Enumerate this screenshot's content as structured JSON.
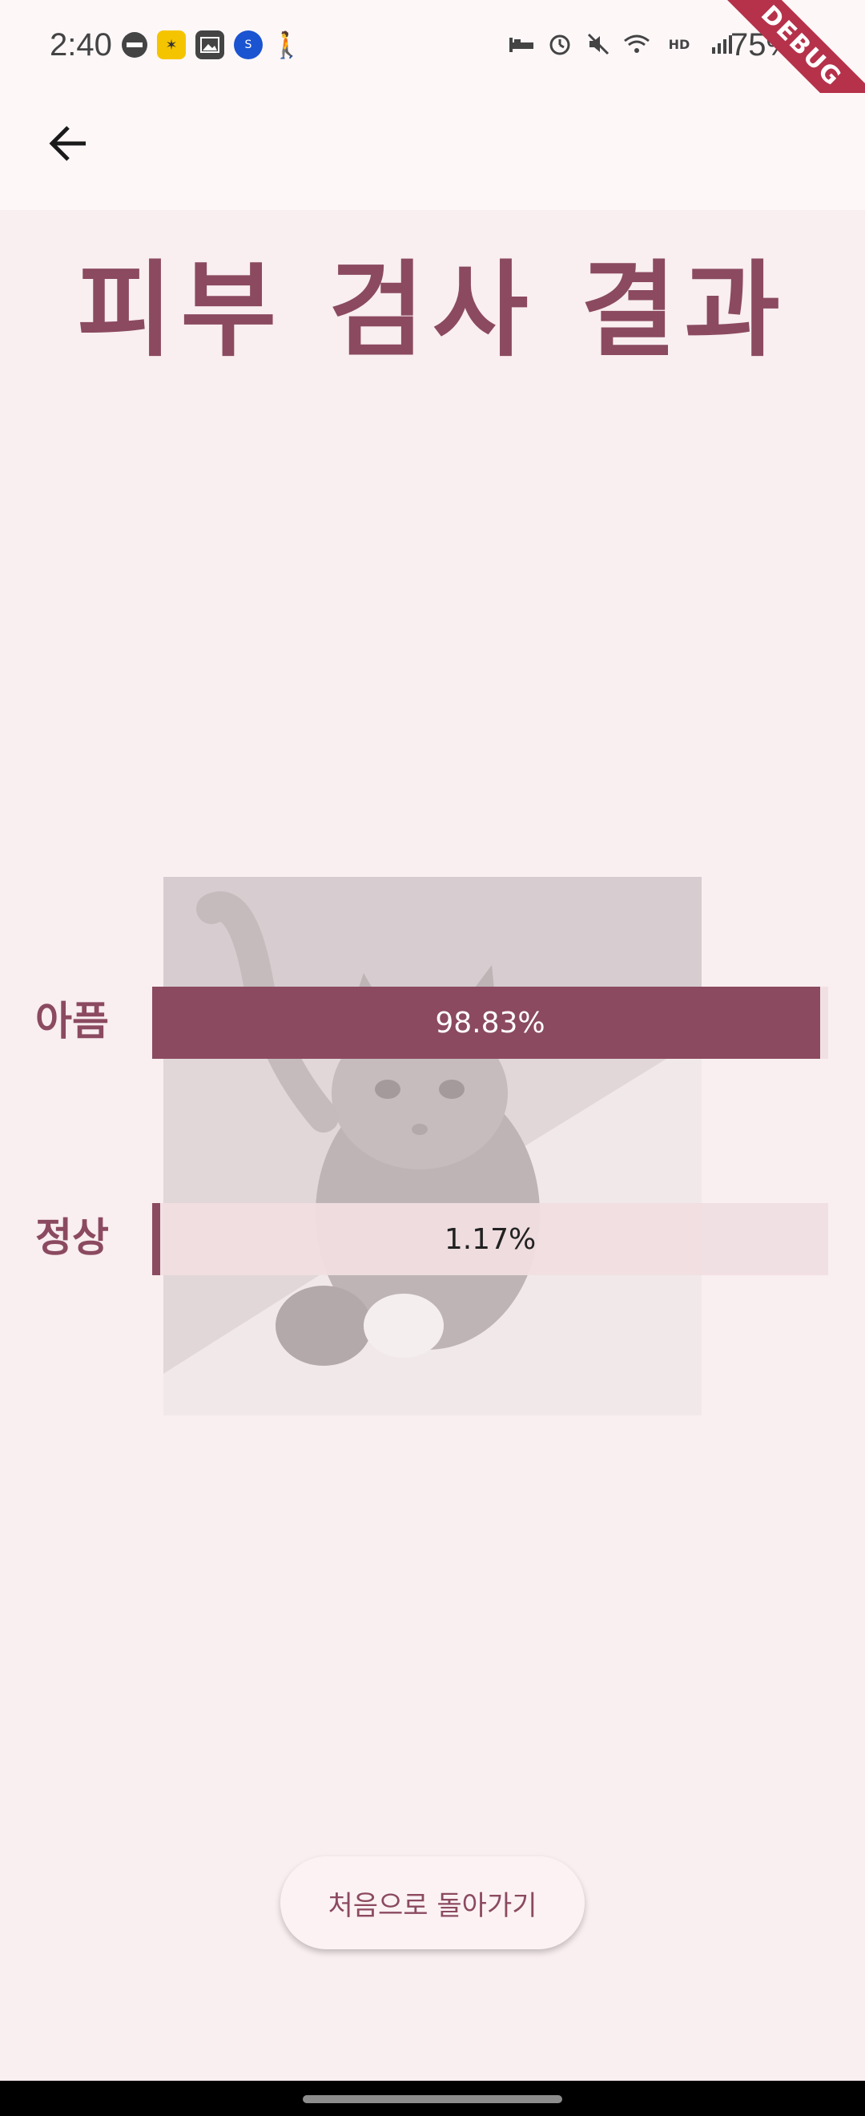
{
  "status_bar": {
    "time": "2:40",
    "battery": "75%",
    "left_icons": [
      "do-not-disturb-icon",
      "app-notification-icon",
      "gallery-icon",
      "super-sol-icon",
      "walking-icon"
    ],
    "right_icons": [
      "bed-icon",
      "alarm-icon",
      "mute-icon",
      "wifi-icon",
      "hd-voice-icon",
      "signal-icon"
    ],
    "debug_banner": "DEBUG"
  },
  "app_bar": {
    "back_icon": "arrow-left-icon"
  },
  "page": {
    "title": "피부 검사 결과"
  },
  "results": [
    {
      "label": "아픔",
      "value_text": "98.83%",
      "fraction": 0.9883
    },
    {
      "label": "정상",
      "value_text": "1.17%",
      "fraction": 0.0117
    }
  ],
  "photo": {
    "subject": "cat-photo"
  },
  "actions": {
    "home_button": "처음으로 돌아가기"
  },
  "colors": {
    "accent": "#8b4a60",
    "background": "#f9eef0",
    "track": "#f0dee2",
    "debug": "#b5324a"
  }
}
